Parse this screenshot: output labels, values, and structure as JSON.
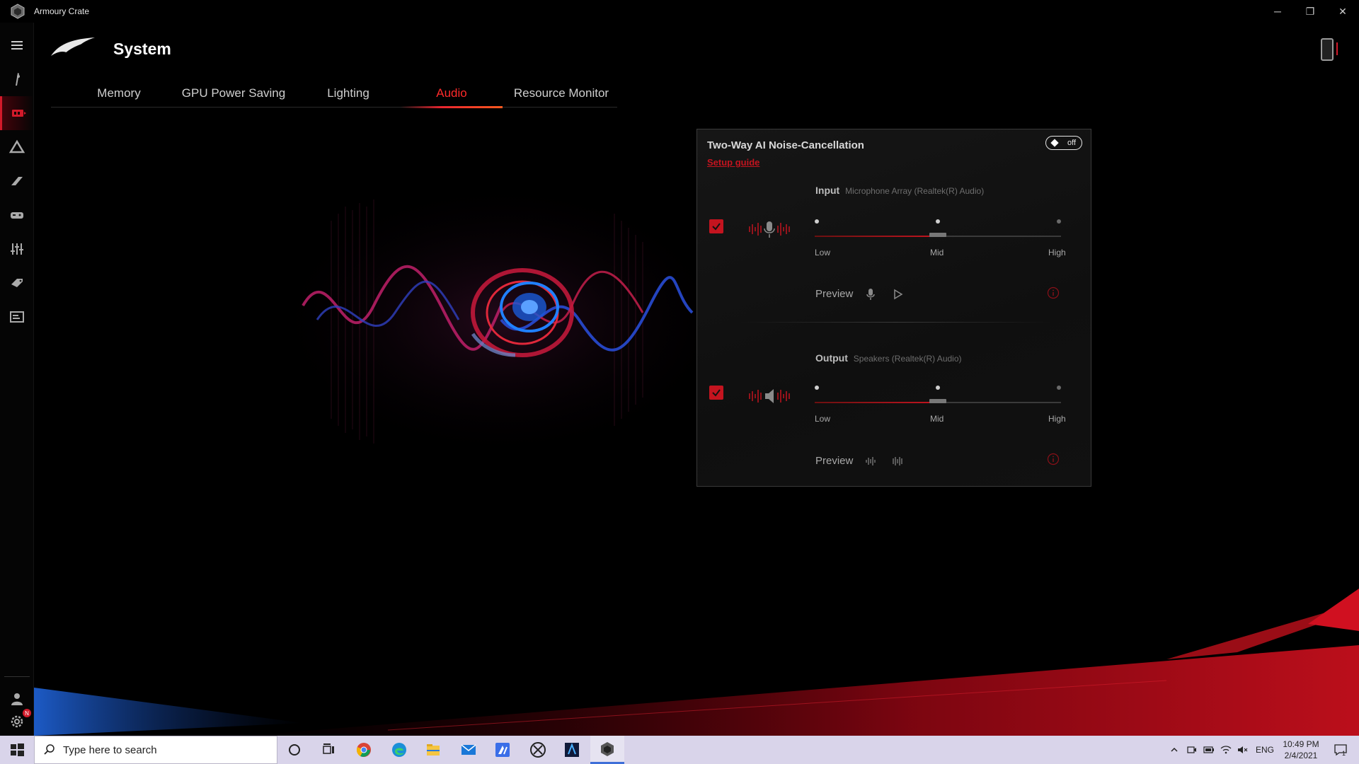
{
  "window": {
    "title": "Armoury Crate",
    "controls": {
      "minimize": "─",
      "restore": "❐",
      "close": "✕"
    }
  },
  "header": {
    "title": "System"
  },
  "tabs": [
    {
      "label": "Memory",
      "active": false
    },
    {
      "label": "GPU Power Saving",
      "active": false
    },
    {
      "label": "Lighting",
      "active": false
    },
    {
      "label": "Audio",
      "active": true
    },
    {
      "label": "Resource Monitor",
      "active": false
    }
  ],
  "sidebar": {
    "items": [
      "menu-icon",
      "home-icon",
      "system-icon",
      "aura-icon",
      "armoury-icon",
      "gamevisual-icon",
      "scenario-icon",
      "deals-icon",
      "gamelibrary-icon"
    ],
    "bottom": [
      "user-icon",
      "settings-icon"
    ],
    "settings_badge": "N"
  },
  "panel": {
    "title": "Two-Way AI Noise-Cancellation",
    "setup_link": "Setup guide",
    "toggle_label": "off",
    "input": {
      "label": "Input",
      "device": "Microphone Array (Realtek(R) Audio)",
      "checked": true,
      "levels": [
        "Low",
        "Mid",
        "High"
      ],
      "selected": "Mid",
      "preview_label": "Preview"
    },
    "output": {
      "label": "Output",
      "device": "Speakers (Realtek(R) Audio)",
      "checked": true,
      "levels": [
        "Low",
        "Mid",
        "High"
      ],
      "selected": "Mid",
      "preview_label": "Preview"
    }
  },
  "taskbar": {
    "search_placeholder": "Type here to search",
    "apps": [
      "cortana-icon",
      "taskview-icon",
      "chrome-icon",
      "edge-icon",
      "explorer-icon",
      "mail-icon",
      "app-icon",
      "xbox-icon",
      "armourycrate-ls-icon",
      "armourycrate-icon"
    ],
    "language": "ENG",
    "time": "10:49 PM",
    "date": "2/4/2021",
    "notification_count": "1"
  },
  "colors": {
    "accent": "#d21a2a",
    "active_tab": "#ff2a2a",
    "taskbar": "#d9d4ea"
  }
}
